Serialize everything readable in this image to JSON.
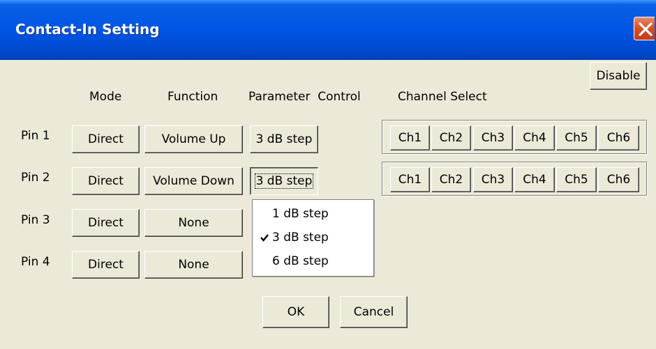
{
  "window": {
    "title": "Contact-In Setting"
  },
  "buttons": {
    "disable": "Disable",
    "ok": "OK",
    "cancel": "Cancel"
  },
  "headers": {
    "mode": "Mode",
    "function": "Function",
    "parameter_control": "Parameter  Control",
    "channel_select": "Channel Select"
  },
  "pins": [
    {
      "label": "Pin 1",
      "mode": "Direct",
      "function": "Volume Up",
      "parameter": "3 dB step",
      "channels": [
        "Ch1",
        "Ch2",
        "Ch3",
        "Ch4",
        "Ch5",
        "Ch6"
      ]
    },
    {
      "label": "Pin 2",
      "mode": "Direct",
      "function": "Volume Down",
      "parameter": "3 dB step",
      "channels": [
        "Ch1",
        "Ch2",
        "Ch3",
        "Ch4",
        "Ch5",
        "Ch6"
      ]
    },
    {
      "label": "Pin 3",
      "mode": "Direct",
      "function": "None"
    },
    {
      "label": "Pin 4",
      "mode": "Direct",
      "function": "None"
    }
  ],
  "parameter_menu": {
    "items": [
      {
        "label": "1 dB step",
        "checked": false
      },
      {
        "label": "3 dB step",
        "checked": true
      },
      {
        "label": "6 dB step",
        "checked": false
      }
    ]
  },
  "icons": {
    "close": "close-icon",
    "check": "checkmark-icon"
  },
  "colors": {
    "titlebar": "#0055e5",
    "close": "#d9532c",
    "face": "#ece9d8"
  }
}
